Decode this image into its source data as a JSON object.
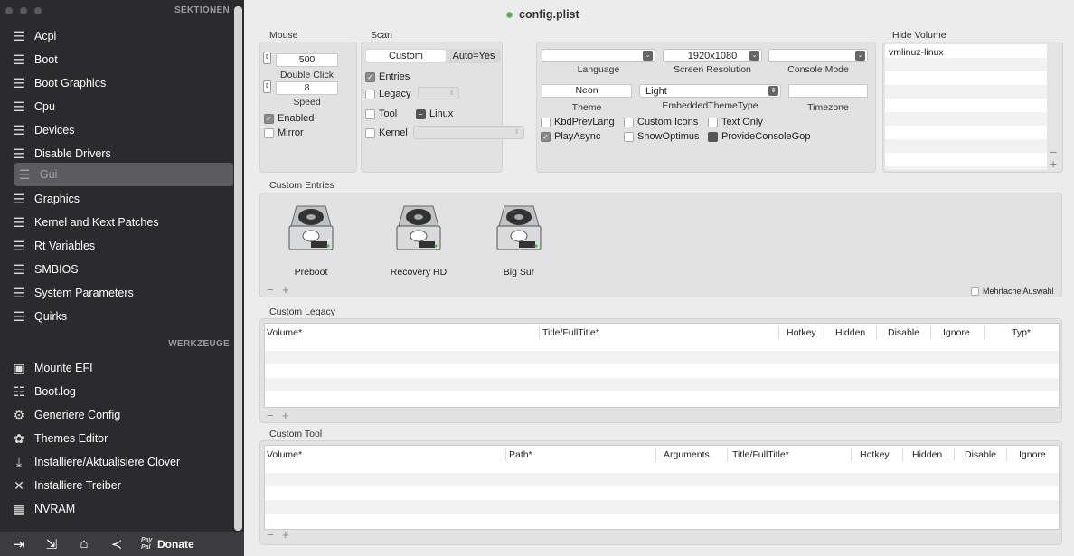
{
  "window": {
    "title": "config.plist"
  },
  "sidebar": {
    "section_header": "SEKTIONEN",
    "tools_header": "WERKZEUGE",
    "sections": [
      {
        "label": "Acpi",
        "icon": "list-icon"
      },
      {
        "label": "Boot",
        "icon": "list-icon"
      },
      {
        "label": "Boot Graphics",
        "icon": "list-icon"
      },
      {
        "label": "Cpu",
        "icon": "list-icon"
      },
      {
        "label": "Devices",
        "icon": "list-icon"
      },
      {
        "label": "Disable Drivers",
        "icon": "list-icon"
      },
      {
        "label": "Gui",
        "icon": "list-icon",
        "selected": true
      },
      {
        "label": "Graphics",
        "icon": "list-icon"
      },
      {
        "label": "Kernel and Kext Patches",
        "icon": "list-icon"
      },
      {
        "label": "Rt Variables",
        "icon": "list-icon"
      },
      {
        "label": "SMBIOS",
        "icon": "list-icon"
      },
      {
        "label": "System Parameters",
        "icon": "list-icon"
      },
      {
        "label": "Quirks",
        "icon": "list-icon"
      }
    ],
    "tools": [
      {
        "label": "Mounte EFI",
        "icon": "disk-icon"
      },
      {
        "label": "Boot.log",
        "icon": "log-search-icon"
      },
      {
        "label": "Generiere Config",
        "icon": "gears-icon"
      },
      {
        "label": "Themes Editor",
        "icon": "palette-icon"
      },
      {
        "label": "Installiere/Aktualisiere Clover",
        "icon": "install-icon"
      },
      {
        "label": "Installiere Treiber",
        "icon": "tools-icon"
      },
      {
        "label": "NVRAM",
        "icon": "chip-icon"
      }
    ],
    "bottom": {
      "donate_label": "Donate",
      "paypal": "Pay Pal"
    }
  },
  "mouse": {
    "label": "Mouse",
    "double_click_value": "500",
    "double_click_label": "Double Click",
    "speed_value": "8",
    "speed_label": "Speed",
    "enabled_label": "Enabled",
    "enabled_checked": true,
    "mirror_label": "Mirror",
    "mirror_checked": false
  },
  "scan": {
    "label": "Scan",
    "seg_custom": "Custom",
    "seg_auto": "Auto=Yes",
    "selected": "Custom",
    "entries_label": "Entries",
    "entries_checked": true,
    "legacy_label": "Legacy",
    "tool_label": "Tool",
    "linux_label": "Linux",
    "kernel_label": "Kernel"
  },
  "gui_opts": {
    "language_label": "Language",
    "language_value": "",
    "resolution_label": "Screen Resolution",
    "resolution_value": "1920x1080",
    "console_label": "Console Mode",
    "console_value": "",
    "theme_label": "Theme",
    "theme_value": "Neon",
    "emb_theme_label": "EmbeddedThemeType",
    "emb_theme_value": "Light",
    "timezone_label": "Timezone",
    "timezone_value": "",
    "kbd_label": "KbdPrevLang",
    "custom_icons_label": "Custom Icons",
    "text_only_label": "Text Only",
    "play_async_label": "PlayAsync",
    "play_async_checked": true,
    "show_optimus_label": "ShowOptimus",
    "provide_console_label": "ProvideConsoleGop"
  },
  "hide_volume": {
    "label": "Hide Volume",
    "items": [
      "vmlinuz-linux"
    ]
  },
  "custom_entries": {
    "label": "Custom Entries",
    "entries": [
      {
        "label": "Preboot"
      },
      {
        "label": "Recovery HD"
      },
      {
        "label": "Big Sur"
      }
    ],
    "multi_label": "Mehrfache Auswahl"
  },
  "custom_legacy": {
    "label": "Custom Legacy",
    "columns": [
      "Volume*",
      "Title/FullTitle*",
      "Hotkey",
      "Hidden",
      "Disable",
      "Ignore",
      "Typ*"
    ]
  },
  "custom_tool": {
    "label": "Custom Tool",
    "columns": [
      "Volume*",
      "Path*",
      "Arguments",
      "Title/FullTitle*",
      "Hotkey",
      "Hidden",
      "Disable",
      "Ignore"
    ]
  },
  "controls": {
    "plus": "+",
    "minus": "−",
    "check": "✓",
    "mixed": "−"
  }
}
